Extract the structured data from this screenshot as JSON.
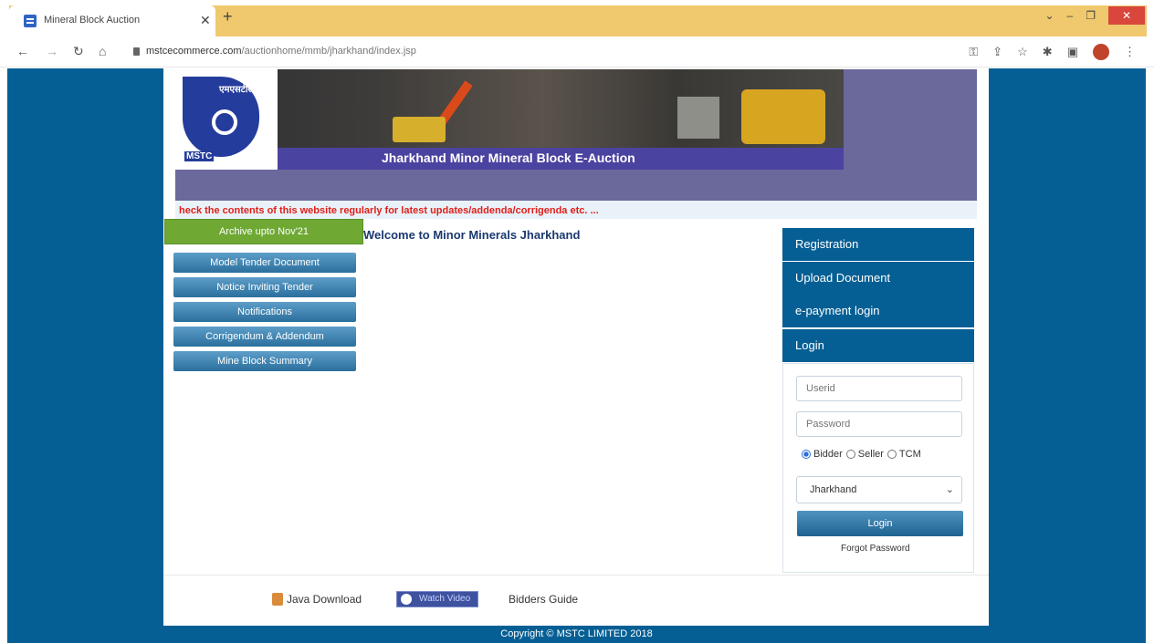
{
  "browser": {
    "tab_title": "Mineral Block Auction",
    "url_host": "mstcecommerce.com",
    "url_path": "/auctionhome/mmb/jharkhand/index.jsp"
  },
  "header": {
    "logo_hindi": "एमएसटीसी",
    "logo_text": "MSTC",
    "banner_title": "Jharkhand Minor Mineral Block E-Auction"
  },
  "marquee": "heck the contents of this website regularly for latest updates/addenda/corrigenda etc. ...",
  "archive_label": "Archive upto Nov'21",
  "welcome": "Welcome to Minor Minerals Jharkhand",
  "menu": [
    "Model Tender Document",
    "Notice Inviting Tender",
    "Notifications",
    "Corrigendum & Addendum",
    "Mine Block Summary"
  ],
  "side": {
    "registration": "Registration",
    "upload": "Upload Document",
    "epayment": "e-payment login",
    "login_header": "Login"
  },
  "login": {
    "userid_placeholder": "Userid",
    "password_placeholder": "Password",
    "radio_bidder": "Bidder",
    "radio_seller": "Seller",
    "radio_tcm": "TCM",
    "selected_state": "Jharkhand",
    "button": "Login",
    "forgot": "Forgot Password"
  },
  "footer": {
    "java": "Java Download",
    "watch": "Watch Video",
    "bidders_guide": "Bidders Guide",
    "copyright": "Copyright © MSTC LIMITED 2018"
  }
}
